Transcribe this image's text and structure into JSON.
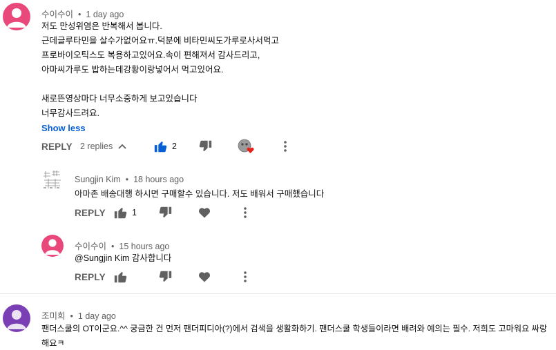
{
  "comment1": {
    "author": "수이수이",
    "time": "1 day ago",
    "lines": [
      "저도 만성위염은 반복해서 봅니다.",
      "근데글루타민을 살수가없어요ㅠ.덕분에 비타민씨도가루로사서먹고",
      "프로바이오틱스도 복용하고있어요.속이 편해져서 감사드리고,",
      "아마씨가루도 밥하는데강황이랑넣어서 먹고있어요.",
      "",
      "새로뜬영상마다 너무소중하게 보고있습니다",
      "너무감사드려요."
    ],
    "show_less": "Show less",
    "reply_label": "REPLY",
    "replies_toggle": "2 replies",
    "like_count": "2",
    "avatar_color": "#e8497a"
  },
  "reply1": {
    "author": "Sungjin Kim",
    "time": "18 hours ago",
    "text": "아마존 배송대행 하시면 구매할수 있습니다. 저도 배워서 구매했습니다",
    "reply_label": "REPLY",
    "like_count": "1"
  },
  "reply2": {
    "author": "수이수이",
    "time": "15 hours ago",
    "text": "@Sungjin Kim 감사합니다",
    "reply_label": "REPLY",
    "avatar_color": "#e8497a"
  },
  "comment2": {
    "author": "조미희",
    "time": "1 day ago",
    "lines": [
      "팬더스쿨의 OT이군요.^^ 궁금한 건 먼저 팬더피디아(?)에서  검색을 생활화하기.  팬더스쿨 학생들이라면 배려와 예의는 필수. 저희도 고마워요 싸랑",
      "해요ㅋ"
    ],
    "avatar_color": "#7b3fb5"
  },
  "colors": {
    "link": "#065fd4",
    "liked": "#065fd4",
    "icon": "#606060",
    "heart": "#e62117"
  }
}
